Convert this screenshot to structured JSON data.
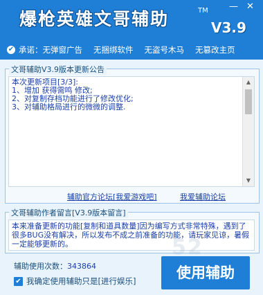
{
  "app": {
    "title": "爆枪英雄文哥辅助",
    "trademark": "TM",
    "version": "V3.9",
    "minimize_glyph": "—",
    "close_glyph": "✕"
  },
  "promises": {
    "prefix": "承诺：",
    "items": [
      "无弹窗广告",
      "无捆绑软件",
      "无盗号木马",
      "无篡改主页"
    ]
  },
  "update_notice": {
    "title": "文哥辅助V3.9版本更新公告",
    "lines": [
      "本次更新项目[3/3]:",
      "1、增加 获得需鸣 修改;",
      "2、对复制存档功能进行了修改优化;",
      "3、对辅助格局进行的微微的调整."
    ]
  },
  "links": {
    "forum": "辅助官方论坛[我爱游戏吧]",
    "forum2": "我爱辅助论坛"
  },
  "author_message": {
    "title": "文哥辅助作者留言[V3.9版本留言]",
    "text": "本来准备更新的功能[复制和道具数量]因为编写方式非常特殊，遇到了很多BUG没有解决，所以发布不成之前准备的功能，请玩家见谅，暑假一定能够更新的。"
  },
  "usage": {
    "label": "辅助使用次数：",
    "value": "343864"
  },
  "confirm": {
    "label": "我确定使用辅助只是[进行娱乐]",
    "checked": true
  },
  "use_button": {
    "label": "使用辅助"
  },
  "watermark": "52",
  "colors": {
    "primary": "#1f7fd6",
    "text": "#1a3fa8",
    "background": "#e8f3fc"
  }
}
